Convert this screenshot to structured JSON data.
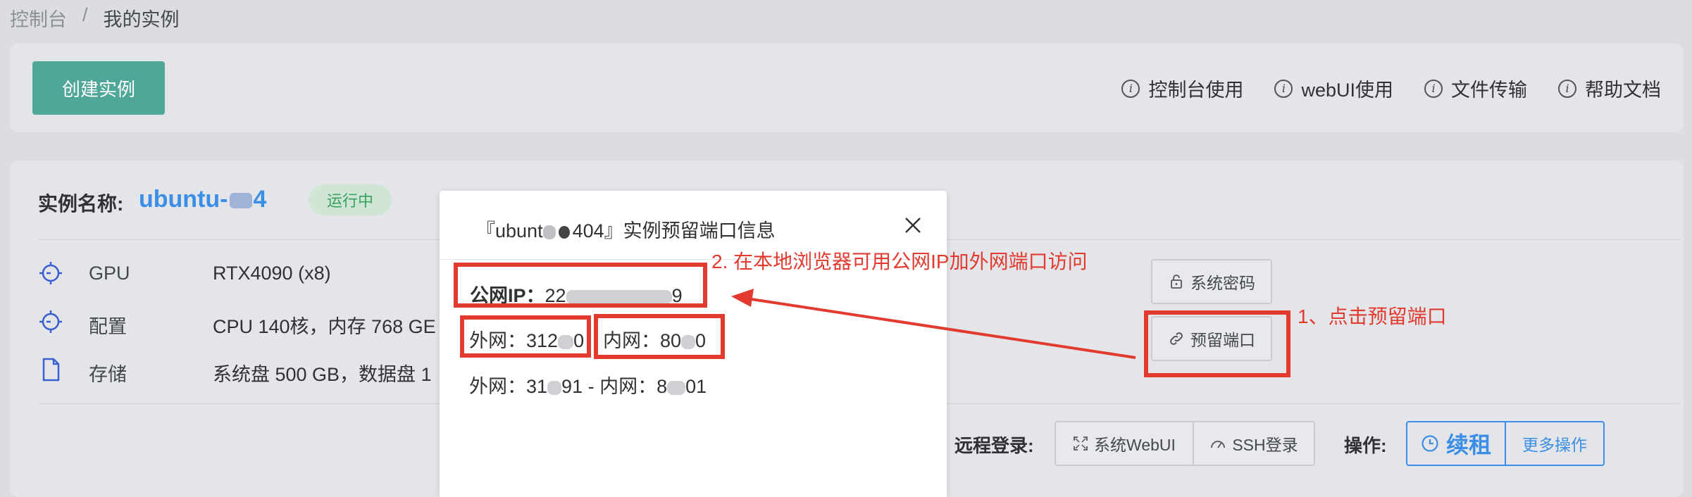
{
  "breadcrumb": {
    "root": "控制台",
    "sep": "/",
    "current": "我的实例"
  },
  "toolbar": {
    "create_label": "创建实例"
  },
  "help_links": [
    {
      "icon": "info-icon",
      "label": "控制台使用"
    },
    {
      "icon": "info-icon",
      "label": "webUI使用"
    },
    {
      "icon": "info-icon",
      "label": "文件传输"
    },
    {
      "icon": "info-icon",
      "label": "帮助文档"
    }
  ],
  "instance": {
    "name_label": "实例名称:",
    "name_prefix": "ubuntu-",
    "name_suffix": "4",
    "status": "运行中",
    "specs": [
      {
        "icon": "gpu-icon",
        "label": "GPU",
        "value": "RTX4090 (x8)"
      },
      {
        "icon": "config-icon",
        "label": "配置",
        "value": "CPU 140核，内存 768 GE"
      },
      {
        "icon": "storage-icon",
        "label": "存储",
        "value": "系统盘 500 GB，数据盘 1"
      }
    ],
    "buttons": {
      "system_password": "系统密码",
      "reserved_ports": "预留端口"
    },
    "remote_label": "远程登录:",
    "remote_webui": "系统WebUI",
    "remote_ssh": "SSH登录",
    "op_label": "操作:",
    "renew": "续租",
    "more_ops": "更多操作"
  },
  "modal": {
    "title_start": "『ubunt",
    "title_end": "404』实例预留端口信息",
    "public_ip_label": "公网IP：",
    "public_ip_start": "22",
    "public_ip_end": "9",
    "row1_ext": "外网：312",
    "row1_ext_end": "0",
    "row1_int": "内网：80",
    "row1_int_end": "0",
    "row2_start": "外网：31",
    "row2_mid": "91 - 内网：8",
    "row2_end": "01"
  },
  "annotations": {
    "step1": "1、点击预留端口",
    "step2": "2. 在本地浏览器可用公网IP加外网端口访问"
  },
  "colors": {
    "accent_green": "#4fa699",
    "link_blue": "#3a8ee6",
    "annotation_red": "#e23a2f",
    "status_green": "#3aa15e"
  }
}
